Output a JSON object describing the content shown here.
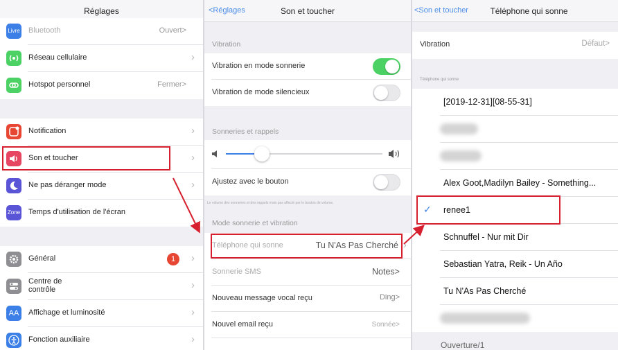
{
  "panel1": {
    "title": "Réglages",
    "rows_top": [
      {
        "label": "Bluetooth",
        "value": "Ouvert>",
        "icon": "bluetooth-icon",
        "icon_text": "Livre",
        "color": "#3c7fe6"
      },
      {
        "label": "Réseau cellulaire",
        "icon": "antenna-icon",
        "color": "#4cd264"
      },
      {
        "label": "Hotspot personnel",
        "value": "Fermer>",
        "icon": "chain-link-icon",
        "color": "#4cd264"
      }
    ],
    "rows_mid": [
      {
        "label": "Notification",
        "icon": "notification-icon",
        "color": "#e64632"
      },
      {
        "label": "Son et toucher",
        "icon": "speaker-icon",
        "color": "#e64662"
      },
      {
        "label": "Ne pas déranger mode",
        "icon": "moon-icon",
        "color": "#5a55d6"
      },
      {
        "label": "Temps d'utilisation de l'écran",
        "icon": "hourglass-icon",
        "icon_text": "Zone",
        "color": "#5a55d6"
      }
    ],
    "rows_bottom": [
      {
        "label": "Général",
        "icon": "gear-icon",
        "color": "#8e8e93",
        "badge": "1"
      },
      {
        "label": "Centre de contrôle",
        "icon": "switches-icon",
        "color": "#8e8e93"
      },
      {
        "label": "Affichage et luminosité",
        "icon": "display-icon",
        "icon_text": "AA",
        "color": "#3c7fe6"
      },
      {
        "label": "Fonction auxiliaire",
        "icon": "accessibility-icon",
        "color": "#3c7fe6"
      }
    ]
  },
  "panel2": {
    "back": "<Réglages",
    "title": "Son et toucher",
    "vibration_header": "Vibration",
    "vib_ring": "Vibration en mode sonnerie",
    "vib_silent": "Vibration de mode silencieux",
    "ringer_header": "Sonneries et rappels",
    "adjust_button": "Ajustez avec le bouton",
    "footnote": "Le volume des sonneries et des rappels mais pas affecté par le bouton de volume.",
    "mode_header": "Mode sonnerie et vibration",
    "rows": [
      {
        "label": "Téléphone qui sonne",
        "value": "Tu N'As Pas Cherché"
      },
      {
        "label": "Sonnerie SMS",
        "value": "Notes>"
      },
      {
        "label": "Nouveau message vocal reçu",
        "value": "Ding>"
      },
      {
        "label": "Nouvel email reçu",
        "value": "Sonnée>"
      }
    ],
    "volume_level": 0.23
  },
  "panel3": {
    "back": "<Son et toucher",
    "title": "Téléphone qui sonne",
    "vibration_label": "Vibration",
    "vibration_value": "Défaut>",
    "list_header": "Téléphone qui sonne",
    "tones": [
      "[2019-12-31][08-55-31]",
      "",
      "",
      "Alex Goot,Madilyn Bailey - Something...",
      "renee1",
      "Schnuffel - Nur mit Dir",
      "Sebastian Yatra,   Reik - Un Año",
      "Tu N'As Pas Cherché",
      ""
    ],
    "selected_tone": "renee1",
    "bottom_cut": "Ouverture/1"
  },
  "colors": {
    "accent": "#3c7fe6",
    "highlight": "#d7202f",
    "toggle_on": "#4cd264"
  }
}
